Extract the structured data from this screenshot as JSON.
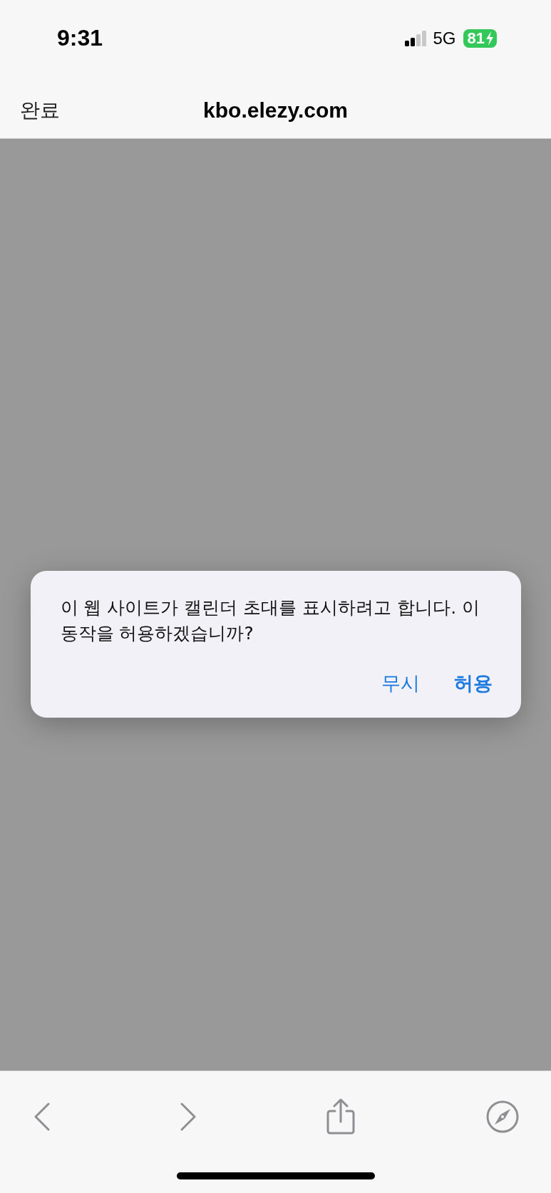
{
  "status_bar": {
    "time": "9:31",
    "network": "5G",
    "battery": "81"
  },
  "nav_bar": {
    "done": "완료",
    "title": "kbo.elezy.com"
  },
  "dialog": {
    "message": "이 웹 사이트가 캘린더 초대를 표시하려고 합니다. 이 동작을 허용하겠습니까?",
    "buttons": [
      {
        "label": "무시",
        "kind": "cancel"
      },
      {
        "label": "허용",
        "kind": "default"
      }
    ]
  }
}
